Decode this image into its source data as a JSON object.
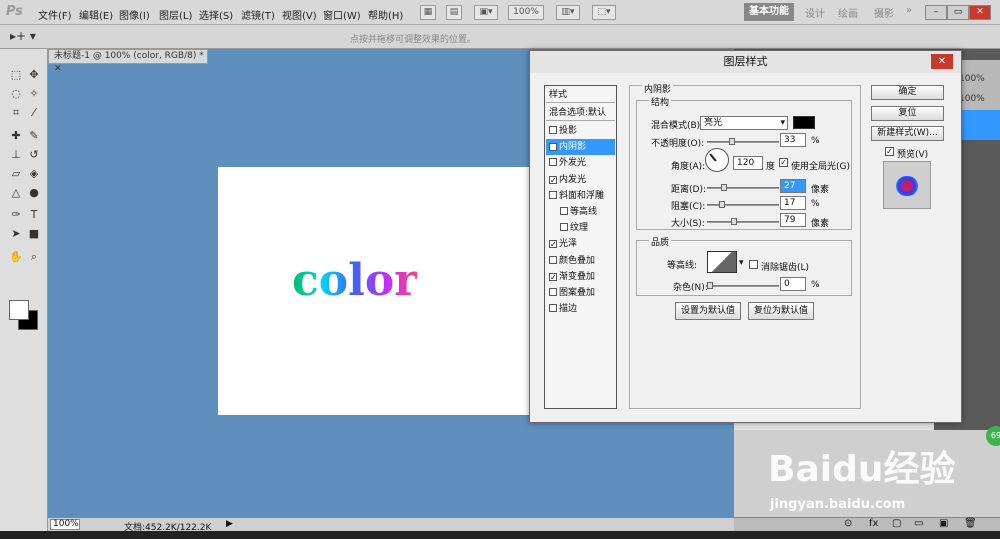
{
  "app": {
    "logo": "Ps"
  },
  "menubar": {
    "items": [
      "文件(F)",
      "编辑(E)",
      "图像(I)",
      "图层(L)",
      "选择(S)",
      "滤镜(T)",
      "视图(V)",
      "窗口(W)",
      "帮助(H)"
    ],
    "zoom": "100%",
    "workspaces": [
      "基本功能",
      "设计",
      "绘画",
      "摄影"
    ],
    "window_buttons": [
      "–",
      "▭",
      "✕"
    ]
  },
  "optionsbar": {
    "hint": "点按并拖移可调整效果的位置。"
  },
  "document": {
    "tab_title": "未标题-1 @ 100% (color, RGB/8) *",
    "canvas_text": "color",
    "zoom": "100%",
    "doc_info": "文档:452.2K/122.2K"
  },
  "watermark": {
    "brand": "Baidu经验",
    "url": "jingyan.baidu.com"
  },
  "right_panel": {
    "badge": "69",
    "percent_1": "100%",
    "percent_2": "100%"
  },
  "dialog": {
    "title": "图层样式",
    "close_label": "✕",
    "styles_header": "样式",
    "blend_default": "混合选项:默认",
    "styles": [
      {
        "label": "投影",
        "checked": false,
        "selected": false
      },
      {
        "label": "内阴影",
        "checked": true,
        "selected": true
      },
      {
        "label": "外发光",
        "checked": false,
        "selected": false
      },
      {
        "label": "内发光",
        "checked": true,
        "selected": false
      },
      {
        "label": "斜面和浮雕",
        "checked": false,
        "selected": false
      },
      {
        "label": "等高线",
        "checked": false,
        "selected": false,
        "indent": true
      },
      {
        "label": "纹理",
        "checked": false,
        "selected": false,
        "indent": true
      },
      {
        "label": "光泽",
        "checked": true,
        "selected": false
      },
      {
        "label": "颜色叠加",
        "checked": false,
        "selected": false
      },
      {
        "label": "渐变叠加",
        "checked": true,
        "selected": false
      },
      {
        "label": "图案叠加",
        "checked": false,
        "selected": false
      },
      {
        "label": "描边",
        "checked": false,
        "selected": false
      }
    ],
    "section_title": "内阴影",
    "structure": {
      "title": "结构",
      "blend_mode_label": "混合模式(B):",
      "blend_mode_value": "亮光",
      "blend_color": "#000000",
      "opacity_label": "不透明度(O):",
      "opacity_value": "33",
      "opacity_unit": "%",
      "angle_label": "角度(A):",
      "angle_value": "120",
      "angle_unit": "度",
      "global_light_label": "使用全局光(G)",
      "global_light_checked": true,
      "distance_label": "距离(D):",
      "distance_value": "27",
      "distance_unit": "像素",
      "choke_label": "阻塞(C):",
      "choke_value": "17",
      "choke_unit": "%",
      "size_label": "大小(S):",
      "size_value": "79",
      "size_unit": "像素"
    },
    "quality": {
      "title": "品质",
      "contour_label": "等高线:",
      "antialias_label": "消除锯齿(L)",
      "antialias_checked": false,
      "noise_label": "杂色(N):",
      "noise_value": "0",
      "noise_unit": "%"
    },
    "make_default": "设置为默认值",
    "reset_default": "复位为默认值",
    "ok": "确定",
    "reset": "复位",
    "new_style": "新建样式(W)...",
    "preview_label": "预览(V)",
    "preview_checked": true
  }
}
